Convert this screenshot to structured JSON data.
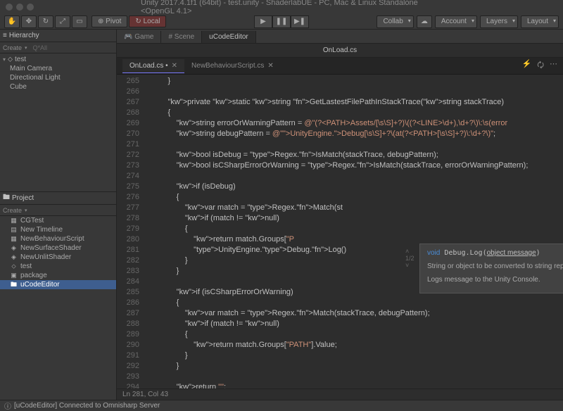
{
  "window": {
    "title": "Unity 2017.4.1f1 (64bit) - test.unity - ShaderlabUE - PC, Mac & Linux Standalone <OpenGL 4.1>"
  },
  "toolbar": {
    "pivot": "Pivot",
    "local": "Local",
    "collab": "Collab",
    "account": "Account",
    "layers": "Layers",
    "layout": "Layout"
  },
  "hierarchy": {
    "title": "Hierarchy",
    "create": "Create",
    "search_placeholder": "Q*All",
    "root": "test",
    "items": [
      "Main Camera",
      "Directional Light",
      "Cube"
    ]
  },
  "project": {
    "title": "Project",
    "create": "Create",
    "items": [
      {
        "name": "CGTest",
        "icon": "cs",
        "selected": false
      },
      {
        "name": "New Timeline",
        "icon": "timeline",
        "selected": false
      },
      {
        "name": "NewBehaviourScript",
        "icon": "cs",
        "selected": false
      },
      {
        "name": "NewSurfaceShader",
        "icon": "shader",
        "selected": false
      },
      {
        "name": "NewUnlitShader",
        "icon": "shader",
        "selected": false
      },
      {
        "name": "test",
        "icon": "scene",
        "selected": false
      },
      {
        "name": "package",
        "icon": "pkg",
        "selected": false
      },
      {
        "name": "uCodeEditor",
        "icon": "folder",
        "selected": true
      }
    ]
  },
  "editor_tabs": {
    "items": [
      "Game",
      "Scene",
      "uCodeEditor"
    ],
    "active": 2
  },
  "file": {
    "current": "OnLoad.cs",
    "tabs": [
      {
        "name": "OnLoad.cs",
        "dirty": true,
        "active": true
      },
      {
        "name": "NewBehaviourScript.cs",
        "dirty": false,
        "active": false
      }
    ]
  },
  "lines": {
    "start": 265,
    "rows": [
      "        }",
      "",
      "        private static string GetLastestFilePathInStackTrace(string stackTrace)",
      "        {",
      "            string errorOrWarningPattern = @\"(?<PATH>Assets/[\\s\\S]+?)\\((?<LINE>\\d+),\\d+?\\)\\:\\s(error",
      "            string debugPattern = @\"UnityEngine.Debug[\\s\\S]+?\\(at(?<PATH>[\\s\\S]+?)\\:\\d+?\\)\";",
      "",
      "            bool isDebug = Regex.IsMatch(stackTrace, debugPattern);",
      "            bool isCSharpErrorOrWarning = Regex.IsMatch(stackTrace, errorOrWarningPattern);",
      "",
      "            if (isDebug)",
      "            {",
      "                var match = Regex.Match(st",
      "                if (match != null)",
      "                {",
      "                    return match.Groups[\"P",
      "                    UnityEngine.Debug.Log()",
      "                }",
      "            }",
      "",
      "            if (isCSharpErrorOrWarning)",
      "            {",
      "                var match = Regex.Match(stackTrace, debugPattern);",
      "                if (match != null)",
      "                {",
      "                    return match.Groups[\"PATH\"].Value;",
      "                }",
      "            }",
      "",
      "            return \"\";",
      "        }"
    ]
  },
  "tooltip": {
    "signature": "void Debug.Log(object message)",
    "param_desc": "String or object to be converted to string representation for display.",
    "summary": "Logs message to the Unity Console.",
    "overload": "1/2"
  },
  "status": {
    "left": "[uCodeEditor] Connected to Omnisharp Server",
    "position": "Ln 281, Col 43"
  }
}
